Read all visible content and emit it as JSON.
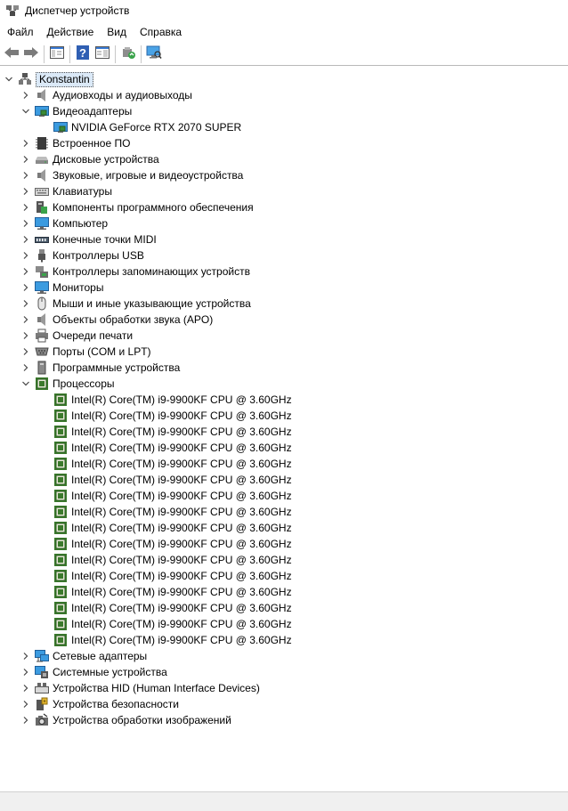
{
  "window": {
    "title": "Диспетчер устройств",
    "icon": "device-manager-icon"
  },
  "menu": [
    "Файл",
    "Действие",
    "Вид",
    "Справка"
  ],
  "toolbar": [
    {
      "name": "back-button",
      "icon": "arrow-left-icon"
    },
    {
      "name": "forward-button",
      "icon": "arrow-right-icon"
    },
    {
      "name": "show-hide-console-tree-button",
      "icon": "console-tree-icon"
    },
    {
      "name": "help-button",
      "icon": "help-icon"
    },
    {
      "name": "properties-pane-button",
      "icon": "properties-icon"
    },
    {
      "name": "update-driver-button",
      "icon": "update-driver-icon"
    },
    {
      "name": "scan-hardware-button",
      "icon": "monitor-scan-icon"
    }
  ],
  "tree": {
    "root": "Konstantin",
    "categories": [
      {
        "label": "Аудиовходы и аудиовыходы",
        "icon": "speaker-icon",
        "expanded": false
      },
      {
        "label": "Видеоадаптеры",
        "icon": "display-adapter-icon",
        "expanded": true,
        "children": [
          "NVIDIA GeForce RTX 2070 SUPER"
        ]
      },
      {
        "label": "Встроенное ПО",
        "icon": "firmware-icon",
        "expanded": false
      },
      {
        "label": "Дисковые устройства",
        "icon": "disk-icon",
        "expanded": false
      },
      {
        "label": "Звуковые, игровые и видеоустройства",
        "icon": "speaker-icon",
        "expanded": false
      },
      {
        "label": "Клавиатуры",
        "icon": "keyboard-icon",
        "expanded": false
      },
      {
        "label": "Компоненты программного обеспечения",
        "icon": "software-component-icon",
        "expanded": false
      },
      {
        "label": "Компьютер",
        "icon": "computer-icon",
        "expanded": false
      },
      {
        "label": "Конечные точки MIDI",
        "icon": "midi-icon",
        "expanded": false
      },
      {
        "label": "Контроллеры USB",
        "icon": "usb-icon",
        "expanded": false
      },
      {
        "label": "Контроллеры запоминающих устройств",
        "icon": "storage-controller-icon",
        "expanded": false
      },
      {
        "label": "Мониторы",
        "icon": "monitor-icon",
        "expanded": false
      },
      {
        "label": "Мыши и иные указывающие устройства",
        "icon": "mouse-icon",
        "expanded": false
      },
      {
        "label": "Объекты обработки звука (APO)",
        "icon": "speaker-icon",
        "expanded": false
      },
      {
        "label": "Очереди печати",
        "icon": "printer-icon",
        "expanded": false
      },
      {
        "label": "Порты (COM и LPT)",
        "icon": "port-icon",
        "expanded": false
      },
      {
        "label": "Программные устройства",
        "icon": "software-device-icon",
        "expanded": false
      },
      {
        "label": "Процессоры",
        "icon": "processor-icon",
        "expanded": true,
        "children": [
          "Intel(R) Core(TM) i9-9900KF CPU @ 3.60GHz",
          "Intel(R) Core(TM) i9-9900KF CPU @ 3.60GHz",
          "Intel(R) Core(TM) i9-9900KF CPU @ 3.60GHz",
          "Intel(R) Core(TM) i9-9900KF CPU @ 3.60GHz",
          "Intel(R) Core(TM) i9-9900KF CPU @ 3.60GHz",
          "Intel(R) Core(TM) i9-9900KF CPU @ 3.60GHz",
          "Intel(R) Core(TM) i9-9900KF CPU @ 3.60GHz",
          "Intel(R) Core(TM) i9-9900KF CPU @ 3.60GHz",
          "Intel(R) Core(TM) i9-9900KF CPU @ 3.60GHz",
          "Intel(R) Core(TM) i9-9900KF CPU @ 3.60GHz",
          "Intel(R) Core(TM) i9-9900KF CPU @ 3.60GHz",
          "Intel(R) Core(TM) i9-9900KF CPU @ 3.60GHz",
          "Intel(R) Core(TM) i9-9900KF CPU @ 3.60GHz",
          "Intel(R) Core(TM) i9-9900KF CPU @ 3.60GHz",
          "Intel(R) Core(TM) i9-9900KF CPU @ 3.60GHz",
          "Intel(R) Core(TM) i9-9900KF CPU @ 3.60GHz"
        ]
      },
      {
        "label": "Сетевые адаптеры",
        "icon": "network-adapter-icon",
        "expanded": false
      },
      {
        "label": "Системные устройства",
        "icon": "system-device-icon",
        "expanded": false
      },
      {
        "label": "Устройства HID (Human Interface Devices)",
        "icon": "hid-icon",
        "expanded": false
      },
      {
        "label": "Устройства безопасности",
        "icon": "security-device-icon",
        "expanded": false
      },
      {
        "label": "Устройства обработки изображений",
        "icon": "camera-icon",
        "expanded": false
      }
    ]
  },
  "colors": {
    "selection": "#dbe9f7",
    "separator": "#b9b9b9",
    "processor_green": "#3b7a2c",
    "monitor_blue": "#2f8fd8"
  }
}
